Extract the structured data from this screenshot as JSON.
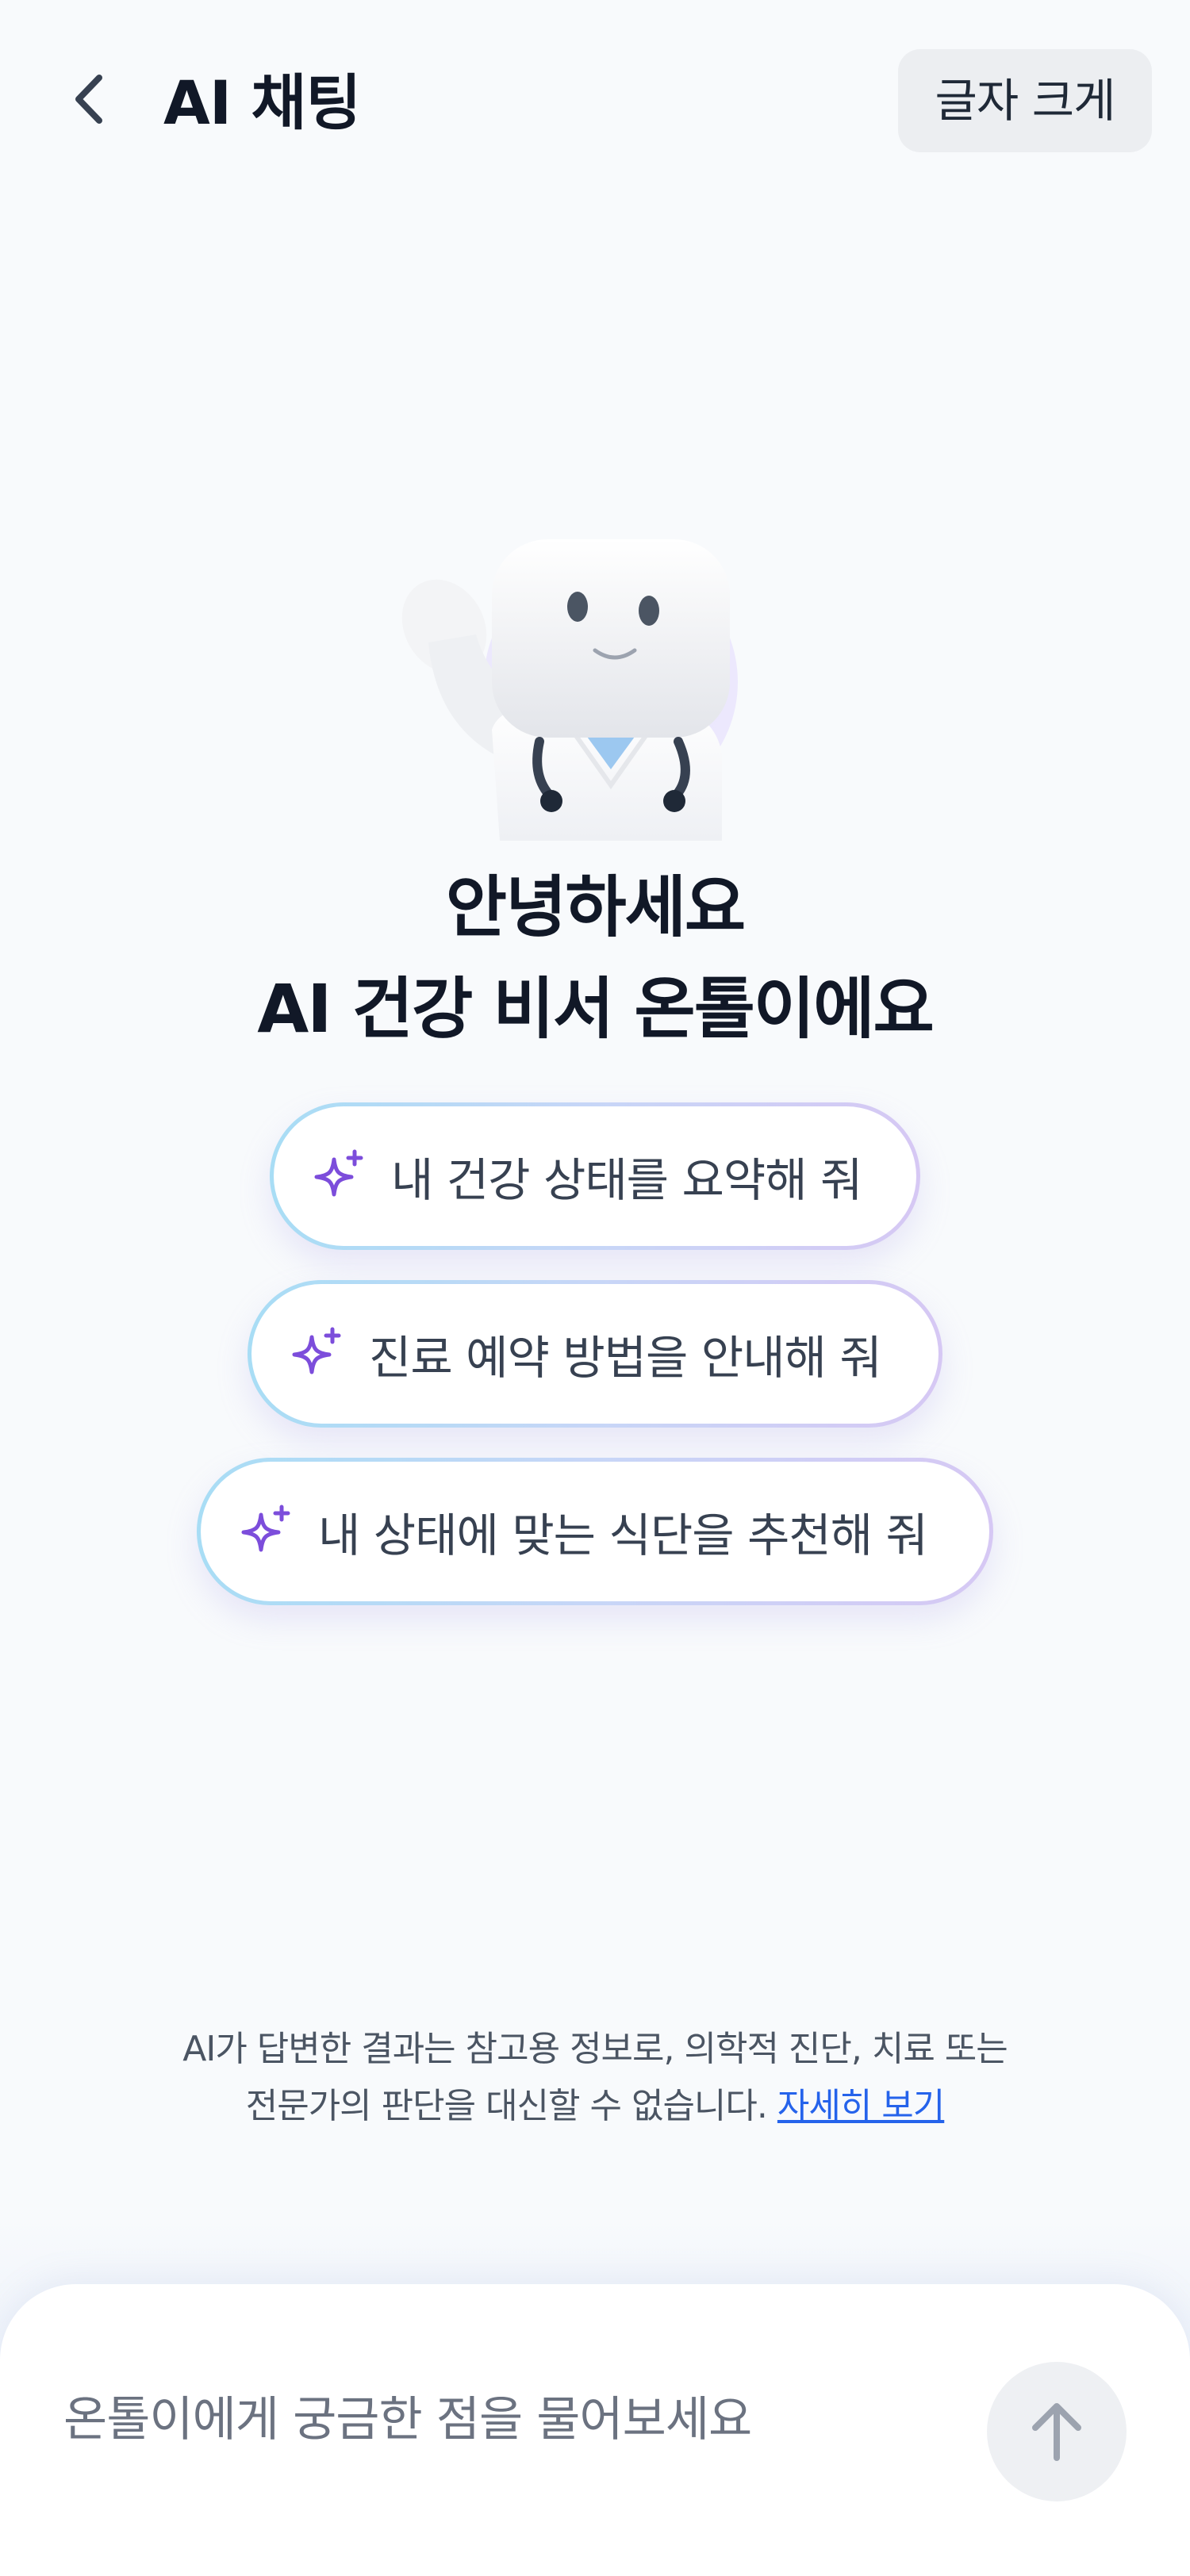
{
  "header": {
    "title": "AI 채팅",
    "font_size_label": "글자 크게",
    "back_icon": "chevron-left-icon"
  },
  "mascot": {
    "icon": "doctor-mascot-avatar"
  },
  "greeting": {
    "line1": "안녕하세요",
    "line2": "AI 건강 비서 온톨이에요"
  },
  "suggestions": [
    {
      "label": "내 건강 상태를 요약해 줘",
      "icon": "sparkle-icon"
    },
    {
      "label": "진료 예약 방법을 안내해 줘",
      "icon": "sparkle-icon"
    },
    {
      "label": "내 상태에 맞는 식단을 추천해 줘",
      "icon": "sparkle-icon"
    }
  ],
  "disclaimer": {
    "line1": "AI가 답변한 결과는 참고용 정보로, 의학적 진단, 치료 또는",
    "line2": "전문가의 판단을 대신할 수 없습니다.",
    "link": "자세히 보기"
  },
  "composer": {
    "placeholder": "온톨이에게 궁금한 점을 물어보세요",
    "value": "",
    "send_icon": "arrow-up-icon"
  },
  "colors": {
    "accent_purple": "#7c4ddb",
    "link_blue": "#2563eb",
    "background": "#f8fafc"
  }
}
